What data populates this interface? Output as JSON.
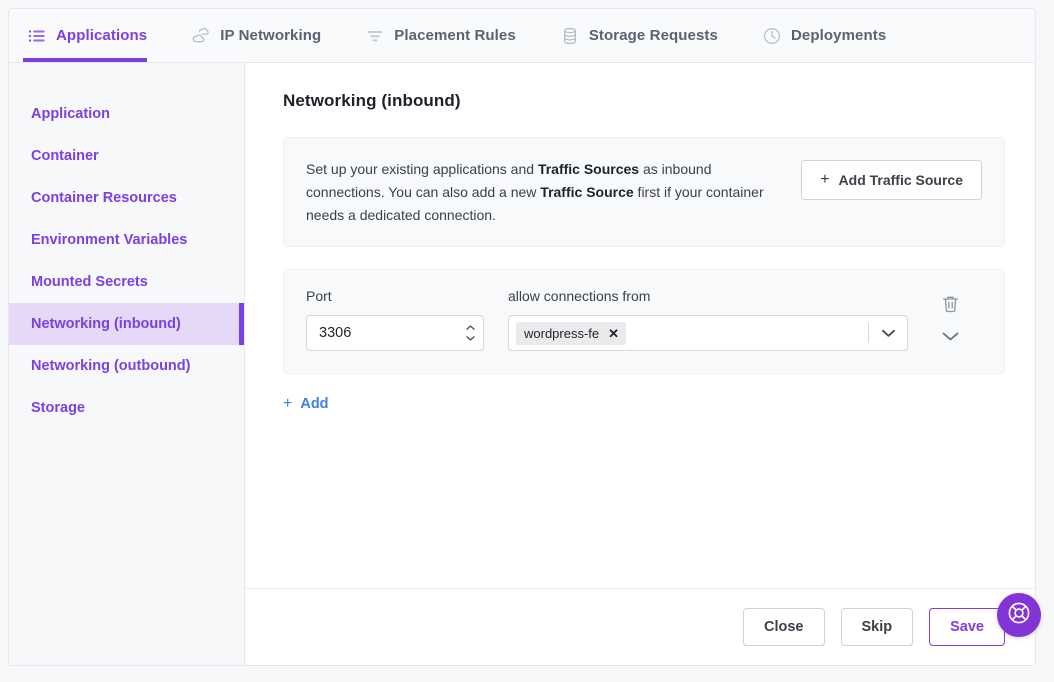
{
  "tabs": [
    {
      "label": "Applications",
      "icon": "list-icon",
      "active": true
    },
    {
      "label": "IP Networking",
      "icon": "clouds-icon",
      "active": false
    },
    {
      "label": "Placement Rules",
      "icon": "filter-icon",
      "active": false
    },
    {
      "label": "Storage Requests",
      "icon": "database-icon",
      "active": false
    },
    {
      "label": "Deployments",
      "icon": "clock-icon",
      "active": false
    }
  ],
  "sidebar": {
    "items": [
      {
        "label": "Application",
        "active": false
      },
      {
        "label": "Container",
        "active": false
      },
      {
        "label": "Container Resources",
        "active": false
      },
      {
        "label": "Environment Variables",
        "active": false
      },
      {
        "label": "Mounted Secrets",
        "active": false
      },
      {
        "label": "Networking (inbound)",
        "active": true
      },
      {
        "label": "Networking (outbound)",
        "active": false
      },
      {
        "label": "Storage",
        "active": false
      }
    ]
  },
  "main": {
    "title": "Networking (inbound)",
    "info": {
      "text_part1": "Set up your existing applications and ",
      "bold1": "Traffic Sources",
      "text_part2": " as inbound connections. You can also add a new ",
      "bold2": "Traffic Source",
      "text_part3": " first if your container needs a dedicated connection.",
      "add_button_label": "Add Traffic Source",
      "plus": "+"
    },
    "form": {
      "port_label": "Port",
      "port_value": "3306",
      "allow_label": "allow connections from",
      "chips": [
        {
          "label": "wordpress-fe",
          "remove": "✕"
        }
      ]
    },
    "add_row_label": "Add",
    "add_row_plus": "+"
  },
  "footer": {
    "close_label": "Close",
    "skip_label": "Skip",
    "save_label": "Save"
  },
  "colors": {
    "accent_purple": "#7b3fe4",
    "fab_purple": "#8234d6",
    "link_blue": "#3d7eeb",
    "sidebar_active_bg": "#e6d9f7"
  }
}
